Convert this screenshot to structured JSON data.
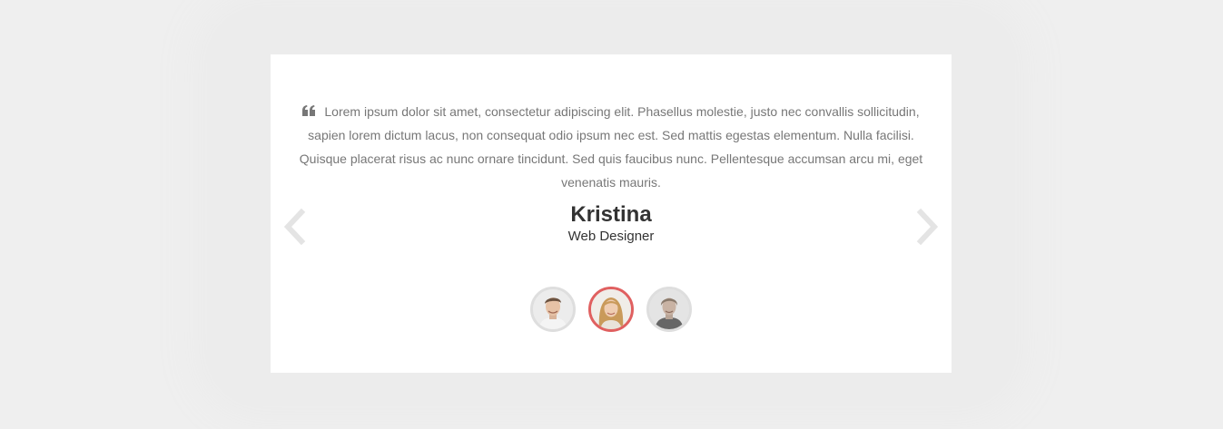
{
  "testimonial": {
    "quote": "Lorem ipsum dolor sit amet, consectetur adipiscing elit. Phasellus molestie, justo nec convallis sollicitudin, sapien lorem dictum lacus, non consequat odio ipsum nec est. Sed mattis egestas elementum. Nulla facilisi. Quisque placerat risus ac nunc ornare tincidunt. Sed quis faucibus nunc. Pellentesque accumsan arcu mi, eget venenatis mauris.",
    "name": "Kristina",
    "role": "Web Designer"
  },
  "icons": {
    "quote": "quote-left-icon",
    "prev": "chevron-left-icon",
    "next": "chevron-right-icon"
  },
  "thumbnails": [
    {
      "icon": "man-avatar",
      "active": false
    },
    {
      "icon": "woman-avatar",
      "active": true
    },
    {
      "icon": "man-avatar",
      "active": false
    }
  ],
  "colors": {
    "background": "#efefef",
    "card": "#ffffff",
    "active_ring": "#e06060",
    "inactive_ring": "#dedede",
    "arrow": "#e4e4e4",
    "body_text": "#777777",
    "heading_text": "#333333"
  }
}
